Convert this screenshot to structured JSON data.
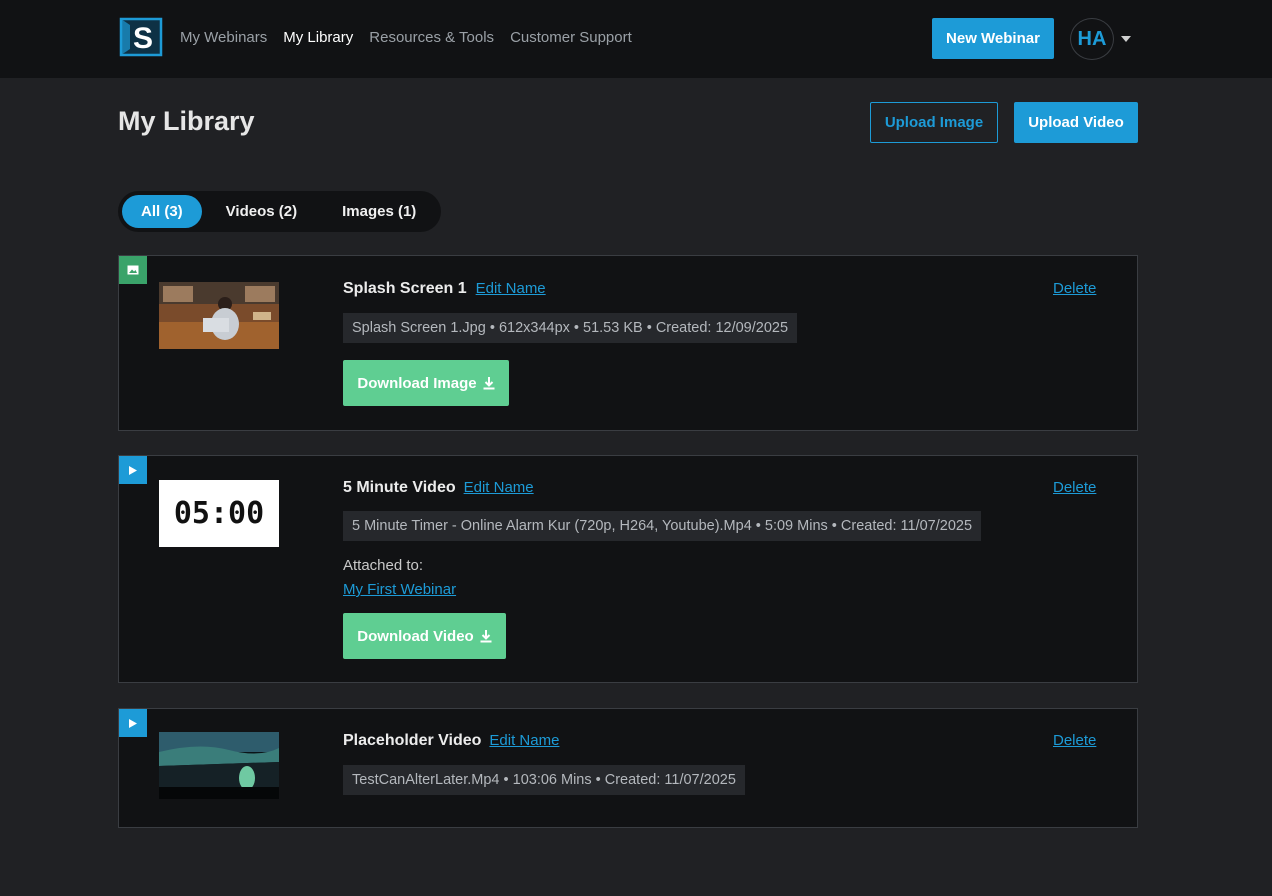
{
  "nav": {
    "links": [
      "My Webinars",
      "My Library",
      "Resources & Tools",
      "Customer Support"
    ],
    "active": "My Library",
    "new_webinar": "New Webinar",
    "avatar_initials": "HA"
  },
  "page": {
    "title": "My Library",
    "upload_image": "Upload Image",
    "upload_video": "Upload Video"
  },
  "filters": {
    "all": "All (3)",
    "videos": "Videos (2)",
    "images": "Images (1)",
    "active": "All (3)"
  },
  "items": [
    {
      "type": "image",
      "title": "Splash Screen 1",
      "edit_label": "Edit Name",
      "delete_label": "Delete",
      "meta": "Splash Screen 1.Jpg • 612x344px • 51.53 KB •  Created: 12/09/2025",
      "download_label": "Download Image"
    },
    {
      "type": "video",
      "title": "5 Minute Video",
      "edit_label": "Edit Name",
      "delete_label": "Delete",
      "thumbnail_text": "05:00",
      "meta": "5 Minute Timer - Online Alarm Kur (720p, H264, Youtube).Mp4 • 5:09 Mins • Created: 11/07/2025",
      "attached_label": "Attached to:",
      "attached_link": "My First Webinar",
      "download_label": "Download Video"
    },
    {
      "type": "video",
      "title": "Placeholder Video",
      "edit_label": "Edit Name",
      "delete_label": "Delete",
      "meta": "TestCanAlterLater.Mp4 • 103:06 Mins • Created: 11/07/2025"
    }
  ],
  "colors": {
    "accent": "#1d9bd7",
    "download": "#5fce92",
    "image_badge": "#3aa36a",
    "background": "#202124",
    "topbar": "#111214"
  }
}
